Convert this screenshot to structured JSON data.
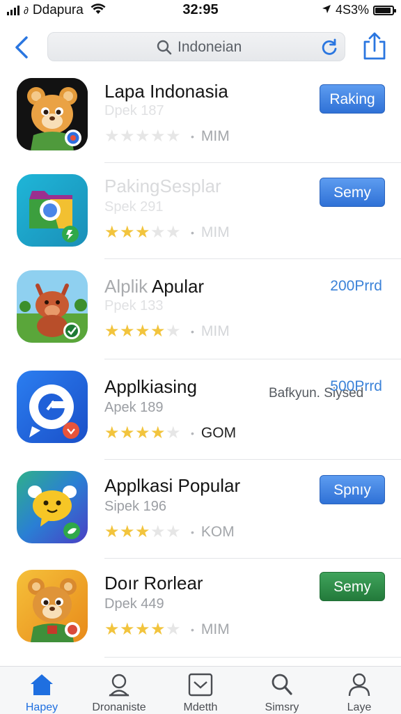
{
  "status_bar": {
    "carrier": "Ddapura",
    "time": "32:95",
    "battery": "4S3%",
    "battery_level": 0.9
  },
  "search": {
    "query": "Indoneian"
  },
  "apps": [
    {
      "title": "Lapa Indonasia",
      "subtitle": "Dpek 187",
      "rating": 0,
      "meta": "MIM",
      "action": {
        "type": "button",
        "label": "Raking",
        "color": "#3b7fe0"
      },
      "icon": "bear-mascot-icon"
    },
    {
      "title": "PakingSesplar",
      "subtitle": "Spek 291",
      "rating": 3,
      "meta": "MIM",
      "action": {
        "type": "button",
        "label": "Semy",
        "color": "#3b7fe0"
      },
      "icon": "browser-folder-icon"
    },
    {
      "title_a": "Alplik",
      "title_b": "Apular",
      "subtitle": "Ppek 133",
      "rating": 4,
      "meta": "MIM",
      "action": {
        "type": "price",
        "label": "200Prrd"
      },
      "note": "Bafkyun. Siysed",
      "icon": "bull-mascot-icon"
    },
    {
      "title": "Applkiasing",
      "subtitle": "Apek 189",
      "rating": 4,
      "meta": "GOM",
      "action": {
        "type": "price",
        "label": "500Prrd"
      },
      "icon": "messenger-g-icon"
    },
    {
      "title": "Applkasi Popular",
      "subtitle": "Sipek 196",
      "rating": 3,
      "meta": "KOM",
      "action": {
        "type": "button",
        "label": "Spnıy",
        "color": "#3b7fe0"
      },
      "icon": "chat-bubble-mascot-icon"
    },
    {
      "title": "Doır Rorlear",
      "subtitle": "Dpek 449",
      "rating": 4,
      "meta": "MIM",
      "action": {
        "type": "button",
        "label": "Semy",
        "color": "#2e8a47"
      },
      "icon": "deer-mascot-icon"
    }
  ],
  "tabs": [
    {
      "label": "Hapey",
      "icon": "home-icon",
      "active": true
    },
    {
      "label": "Dronaniste",
      "icon": "person-badge-icon",
      "active": false
    },
    {
      "label": "Mdetth",
      "icon": "inbox-icon",
      "active": false
    },
    {
      "label": "Simsry",
      "icon": "search-icon",
      "active": false
    },
    {
      "label": "Laye",
      "icon": "profile-icon",
      "active": false
    }
  ],
  "colors": {
    "accent": "#1f6fe0",
    "star": "#f2c43d",
    "button_blue": "#3b7fe0",
    "button_green": "#2e8a47"
  }
}
